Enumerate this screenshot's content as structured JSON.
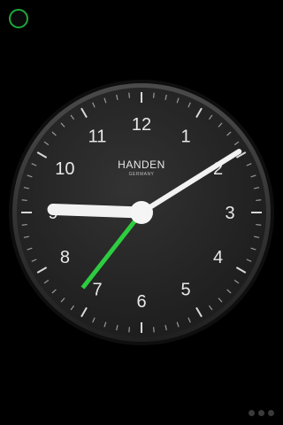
{
  "app": {
    "status_indicator_color": "#1fa83a"
  },
  "clock": {
    "brand": "HANDEN",
    "subtitle": "GERMANY",
    "numerals": [
      "12",
      "1",
      "2",
      "3",
      "4",
      "5",
      "6",
      "7",
      "8",
      "9",
      "10",
      "11"
    ],
    "time": {
      "hour_hand_degrees": 272,
      "minute_hand_degrees": 58,
      "second_hand_degrees": 218
    },
    "colors": {
      "face": "#262626",
      "bezel": "#3a3a3a",
      "rim": "#121212",
      "numerals": "#e8e8e8",
      "hands": "#f2f2f2",
      "second_hand": "#2ecc40"
    }
  },
  "pager": {
    "page_count": 3,
    "active_page": 0
  }
}
